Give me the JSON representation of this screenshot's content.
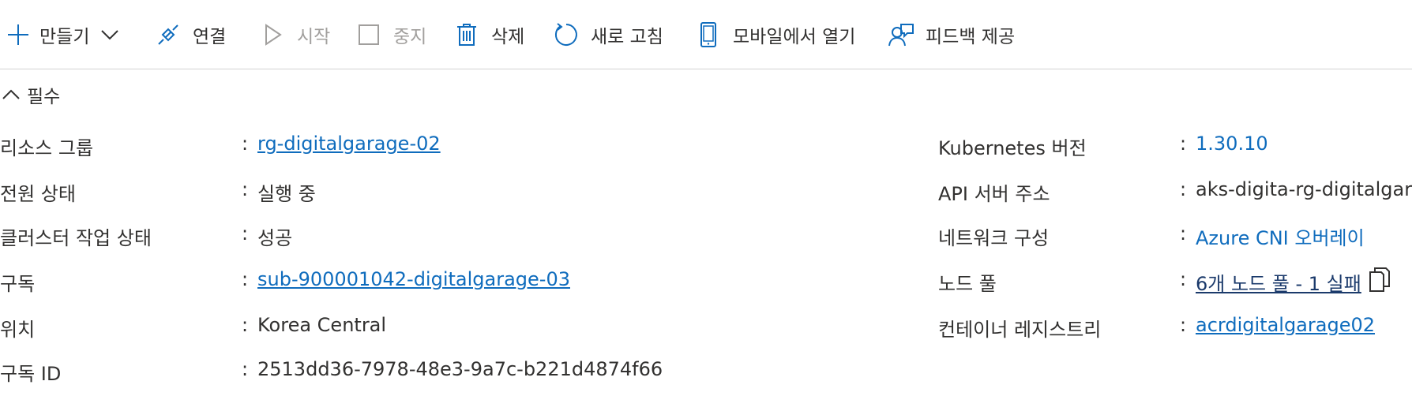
{
  "toolbar": {
    "create": "만들기",
    "connect": "연결",
    "start": "시작",
    "stop": "중지",
    "delete": "삭제",
    "refresh": "새로 고침",
    "mobile": "모바일에서 열기",
    "feedback": "피드백 제공"
  },
  "essentials": {
    "label": "필수"
  },
  "left": {
    "resource_group": {
      "label": "리소스 그룹",
      "value": "rg-digitalgarage-02"
    },
    "power_state": {
      "label": "전원 상태",
      "value": "실행 중"
    },
    "cluster_state": {
      "label": "클러스터 작업 상태",
      "value": "성공"
    },
    "subscription": {
      "label": "구독",
      "value": "sub-900001042-digitalgarage-03"
    },
    "location": {
      "label": "위치",
      "value": "Korea Central"
    },
    "subscription_id": {
      "label": "구독 ID",
      "value": "2513dd36-7978-48e3-9a7c-b221d4874f66"
    }
  },
  "right": {
    "k8s_version": {
      "label": "Kubernetes 버전",
      "value": "1.30.10"
    },
    "api_server": {
      "label": "API 서버 주소",
      "value": "aks-digita-rg-digitalgara"
    },
    "network": {
      "label": "네트워크 구성",
      "value": "Azure CNI 오버레이"
    },
    "node_pools": {
      "label": "노드 풀",
      "value": "6개 노드 풀 - 1 실패"
    },
    "registry": {
      "label": "컨테이너 레지스트리",
      "value": "acrdigitalgarage02"
    }
  },
  "colon": ":",
  "colors": {
    "accent": "#0f6cbd",
    "text": "#323130",
    "disabled": "#a19f9d",
    "divider": "#d1d1d1"
  }
}
